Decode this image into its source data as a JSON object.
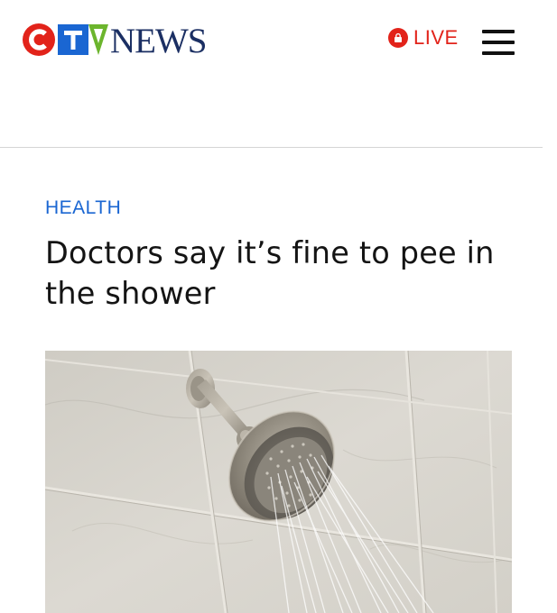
{
  "header": {
    "logo": {
      "letters": [
        "C",
        "T",
        "V"
      ],
      "wordmark": "NEWS",
      "colors": {
        "c": "#e2231a",
        "t": "#1a66d2",
        "v": "#6cb52d",
        "news": "#1b2f63"
      }
    },
    "live_label": "LIVE",
    "live_icon": "live-record-icon",
    "menu_icon": "hamburger-menu-icon"
  },
  "article": {
    "category": "HEALTH",
    "headline": "Doctors say it’s fine to pee in the shower",
    "image": {
      "subject": "shower-head-spraying-water-on-marble-tile"
    }
  },
  "colors": {
    "accent_blue": "#1a66d2",
    "live_red": "#e2231a",
    "headline_text": "#141414",
    "divider": "#d5d5d5"
  }
}
